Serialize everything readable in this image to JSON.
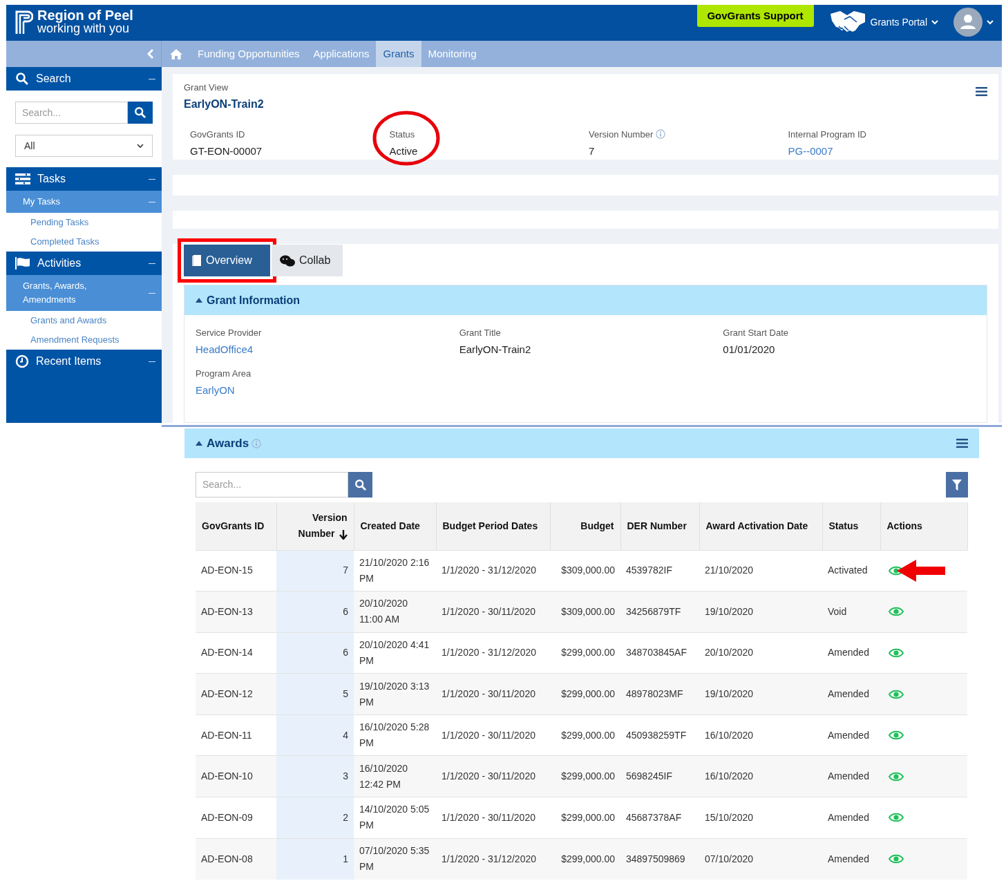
{
  "header": {
    "logo_title": "Region of Peel",
    "logo_tagline": "working with you",
    "support_button": "GovGrants Support",
    "portal_menu": "Grants Portal"
  },
  "nav": {
    "tabs": [
      {
        "label": "Funding Opportunities",
        "selected": false
      },
      {
        "label": "Applications",
        "selected": false
      },
      {
        "label": "Grants",
        "selected": true
      },
      {
        "label": "Monitoring",
        "selected": false
      }
    ]
  },
  "sidebar": {
    "sections": [
      {
        "kind": "search",
        "title": "Search",
        "placeholder": "Search...",
        "filter": "All"
      },
      {
        "kind": "tasks",
        "title": "Tasks",
        "children": [
          {
            "label": "My Tasks",
            "children": [
              {
                "label": "Pending Tasks"
              },
              {
                "label": "Completed Tasks"
              }
            ]
          }
        ]
      },
      {
        "kind": "activities",
        "title": "Activities",
        "children": [
          {
            "label": "Grants, Awards, Amendments",
            "children": [
              {
                "label": "Grants and Awards"
              },
              {
                "label": "Amendment Requests"
              }
            ]
          }
        ]
      },
      {
        "kind": "recent",
        "title": "Recent Items"
      }
    ]
  },
  "grant_view": {
    "label": "Grant View",
    "title": "EarlyON-Train2",
    "fields": [
      {
        "label": "GovGrants ID",
        "value": "GT-EON-00007",
        "kind": "text",
        "info": false,
        "annotated": false
      },
      {
        "label": "Status",
        "value": "Active",
        "kind": "text",
        "info": false,
        "annotated": true
      },
      {
        "label": "Version Number",
        "value": "7",
        "kind": "text",
        "info": true,
        "annotated": false
      },
      {
        "label": "Internal Program ID",
        "value": "PG--0007",
        "kind": "link",
        "info": false,
        "annotated": false
      }
    ]
  },
  "tabs": [
    {
      "label": "Overview",
      "selected": true,
      "annotated": true
    },
    {
      "label": "Collab",
      "selected": false,
      "annotated": false
    }
  ],
  "grant_information": {
    "title": "Grant Information",
    "fields": [
      {
        "label": "Service Provider",
        "value": "HeadOffice4",
        "kind": "link"
      },
      {
        "label": "Grant Title",
        "value": "EarlyON-Train2",
        "kind": "text"
      },
      {
        "label": "Grant Start Date",
        "value": "01/01/2020",
        "kind": "text"
      },
      {
        "label": "Program Area",
        "value": "EarlyON",
        "kind": "link"
      }
    ]
  },
  "awards": {
    "title": "Awards",
    "search_placeholder": "Search...",
    "columns": [
      {
        "label": "GovGrants ID",
        "sorted": false
      },
      {
        "label": "Version Number",
        "sorted": true
      },
      {
        "label": "Created Date",
        "sorted": false
      },
      {
        "label": "Budget Period Dates",
        "sorted": false
      },
      {
        "label": "Budget",
        "sorted": false
      },
      {
        "label": "DER Number",
        "sorted": false
      },
      {
        "label": "Award Activation Date",
        "sorted": false
      },
      {
        "label": "Status",
        "sorted": false
      },
      {
        "label": "Actions",
        "sorted": false
      }
    ],
    "rows": [
      {
        "cells": [
          "AD-EON-15",
          "7",
          "21/10/2020 2:16 PM",
          "1/1/2020 - 31/12/2020",
          "$309,000.00",
          "4539782IF",
          "21/10/2020",
          "Activated"
        ],
        "annotated": true
      },
      {
        "cells": [
          "AD-EON-13",
          "6",
          "20/10/2020 11:00 AM",
          "1/1/2020 - 30/11/2020",
          "$309,000.00",
          "34256879TF",
          "19/10/2020",
          "Void"
        ],
        "annotated": false
      },
      {
        "cells": [
          "AD-EON-14",
          "6",
          "20/10/2020 4:41 PM",
          "1/1/2020 - 31/12/2020",
          "$299,000.00",
          "348703845AF",
          "20/10/2020",
          "Amended"
        ],
        "annotated": false
      },
      {
        "cells": [
          "AD-EON-12",
          "5",
          "19/10/2020 3:13 PM",
          "1/1/2020 - 30/11/2020",
          "$299,000.00",
          "48978023MF",
          "19/10/2020",
          "Amended"
        ],
        "annotated": false
      },
      {
        "cells": [
          "AD-EON-11",
          "4",
          "16/10/2020 5:28 PM",
          "1/1/2020 - 30/11/2020",
          "$299,000.00",
          "450938259TF",
          "16/10/2020",
          "Amended"
        ],
        "annotated": false
      },
      {
        "cells": [
          "AD-EON-10",
          "3",
          "16/10/2020 12:42 PM",
          "1/1/2020 - 30/11/2020",
          "$299,000.00",
          "5698245IF",
          "16/10/2020",
          "Amended"
        ],
        "annotated": false
      },
      {
        "cells": [
          "AD-EON-09",
          "2",
          "14/10/2020 5:05 PM",
          "1/1/2020 - 30/11/2020",
          "$299,000.00",
          "45687378AF",
          "15/10/2020",
          "Amended"
        ],
        "annotated": false
      },
      {
        "cells": [
          "AD-EON-08",
          "1",
          "07/10/2020 5:35 PM",
          "1/1/2020 - 31/12/2020",
          "$299,000.00",
          "34897509869",
          "07/10/2020",
          "Amended"
        ],
        "annotated": false
      }
    ]
  }
}
